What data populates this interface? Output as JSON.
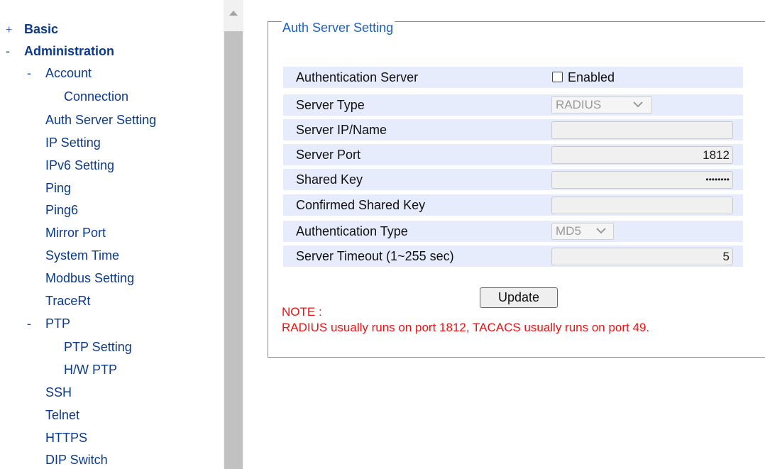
{
  "sidebar": {
    "items": [
      {
        "label": "Basic",
        "mark": "+"
      },
      {
        "label": "Administration",
        "mark": "-"
      },
      {
        "label": "Account",
        "mark": "-"
      },
      {
        "label": "Connection"
      },
      {
        "label": "Auth Server Setting"
      },
      {
        "label": "IP Setting"
      },
      {
        "label": "IPv6 Setting"
      },
      {
        "label": "Ping"
      },
      {
        "label": "Ping6"
      },
      {
        "label": "Mirror Port"
      },
      {
        "label": "System Time"
      },
      {
        "label": "Modbus Setting"
      },
      {
        "label": "TraceRt"
      },
      {
        "label": "PTP",
        "mark": "-"
      },
      {
        "label": "PTP Setting"
      },
      {
        "label": "H/W PTP"
      },
      {
        "label": "SSH"
      },
      {
        "label": "Telnet"
      },
      {
        "label": "HTTPS"
      },
      {
        "label": "DIP Switch"
      }
    ]
  },
  "form": {
    "legend": "Auth Server Setting",
    "rows": [
      {
        "label": "Authentication Server",
        "checkbox_label": "Enabled",
        "checked": false
      },
      {
        "label": "Server Type",
        "value": "RADIUS"
      },
      {
        "label": "Server IP/Name",
        "value": ""
      },
      {
        "label": "Server Port",
        "value": "1812"
      },
      {
        "label": "Shared Key",
        "value": "••••••••"
      },
      {
        "label": "Confirmed Shared Key",
        "value": ""
      },
      {
        "label": "Authentication Type",
        "value": "MD5"
      },
      {
        "label": "Server Timeout (1~255 sec)",
        "value": "5"
      }
    ],
    "update_label": "Update",
    "note_title": "NOTE :",
    "note_text": "RADIUS usually runs on port 1812, TACACS usually runs on port 49."
  },
  "colors": {
    "nav_text": "#0b3a8c",
    "row_bg": "#e6ecfb",
    "legend_text": "#1f5fbf",
    "note_text": "#ee1111"
  }
}
